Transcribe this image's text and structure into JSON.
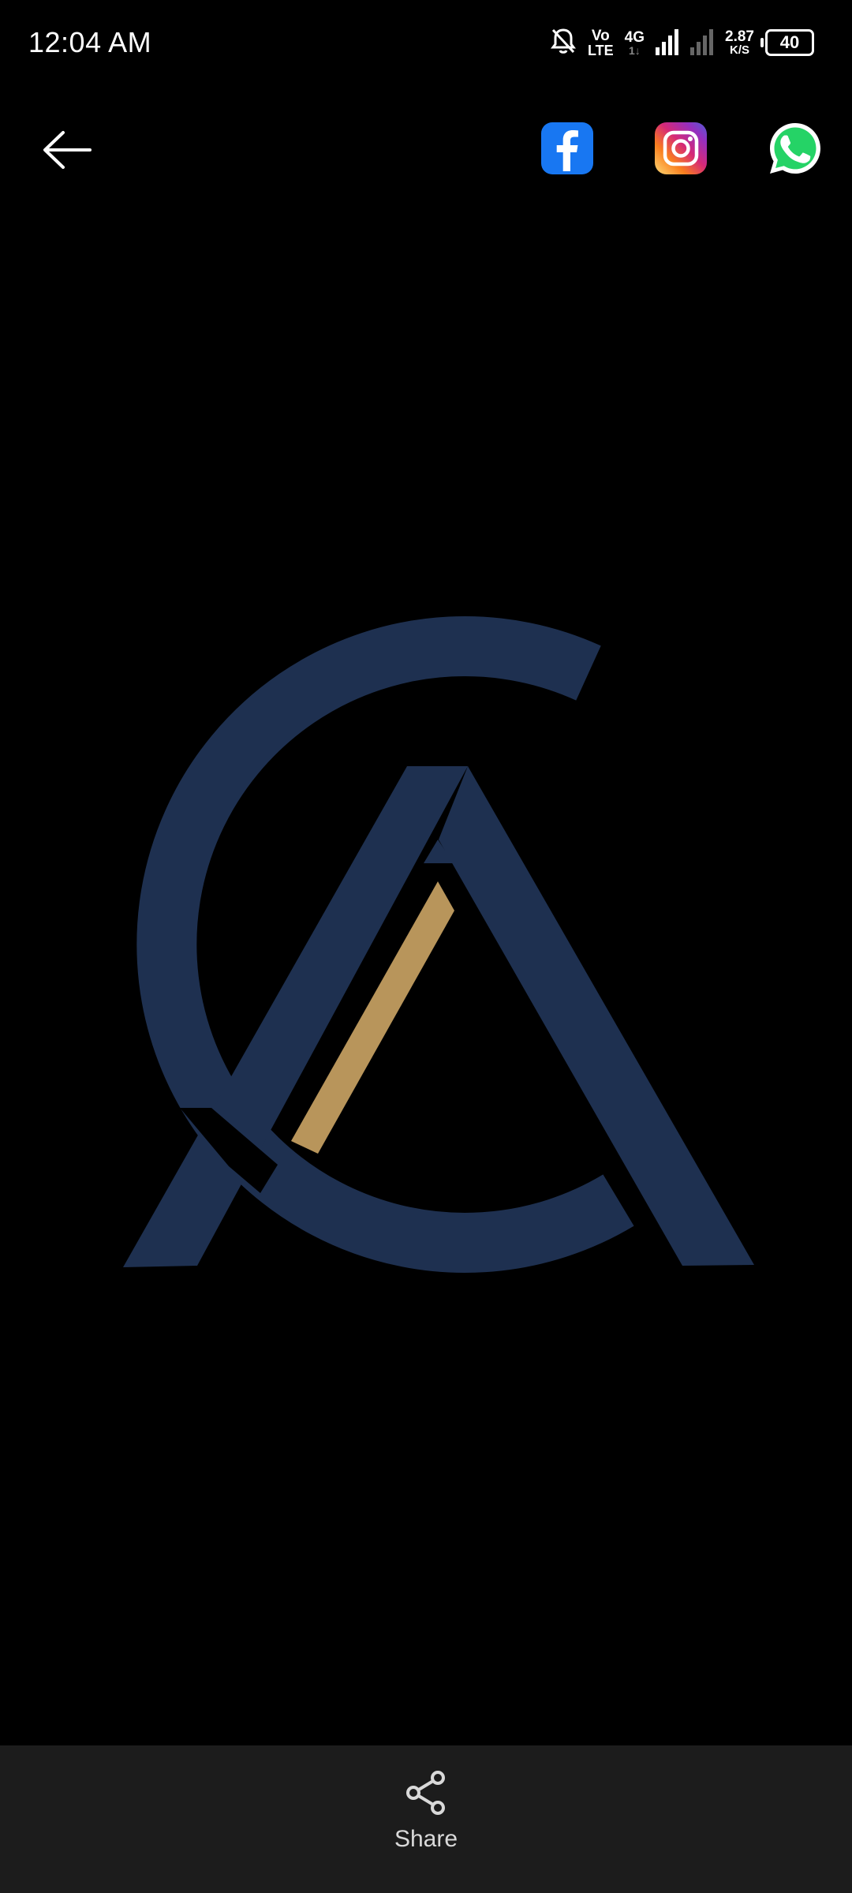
{
  "status_bar": {
    "time": "12:04 AM",
    "volte_top": "Vo",
    "volte_bottom": "LTE",
    "network_type": "4G",
    "network_sub": "1↓",
    "speed_value": "2.87",
    "speed_unit": "K/S",
    "battery_level": "40"
  },
  "toolbar": {
    "back_icon": "arrow-left-icon",
    "social_icons": [
      "facebook-icon",
      "instagram-icon",
      "whatsapp-icon"
    ]
  },
  "logo": {
    "description_colors": {
      "navy": "#1e3050",
      "gold": "#b8955b"
    }
  },
  "bottom_bar": {
    "share_label": "Share",
    "share_icon": "share-icon"
  },
  "colors": {
    "background": "#000000",
    "bottom_bar": "#1c1c1c",
    "facebook": "#1877f2",
    "whatsapp": "#25d366"
  }
}
